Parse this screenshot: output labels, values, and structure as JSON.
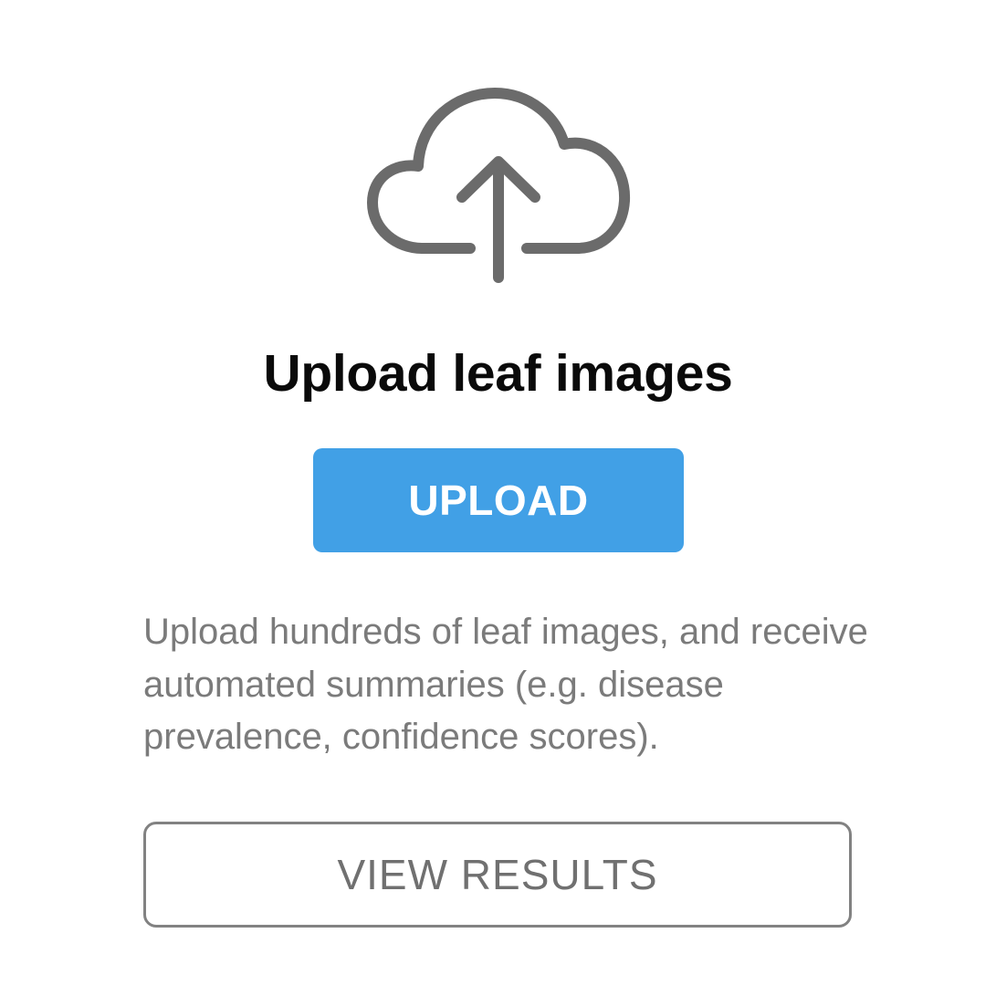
{
  "icon": {
    "name": "cloud-upload-icon",
    "color": "#6b6b6b"
  },
  "title": "Upload leaf images",
  "upload_button": {
    "label": "UPLOAD",
    "color": "#41a0e6"
  },
  "description": "Upload hundreds of leaf images, and receive automated summaries (e.g. disease prevalence, confidence scores).",
  "view_results_button": {
    "label": "VIEW RESULTS"
  }
}
